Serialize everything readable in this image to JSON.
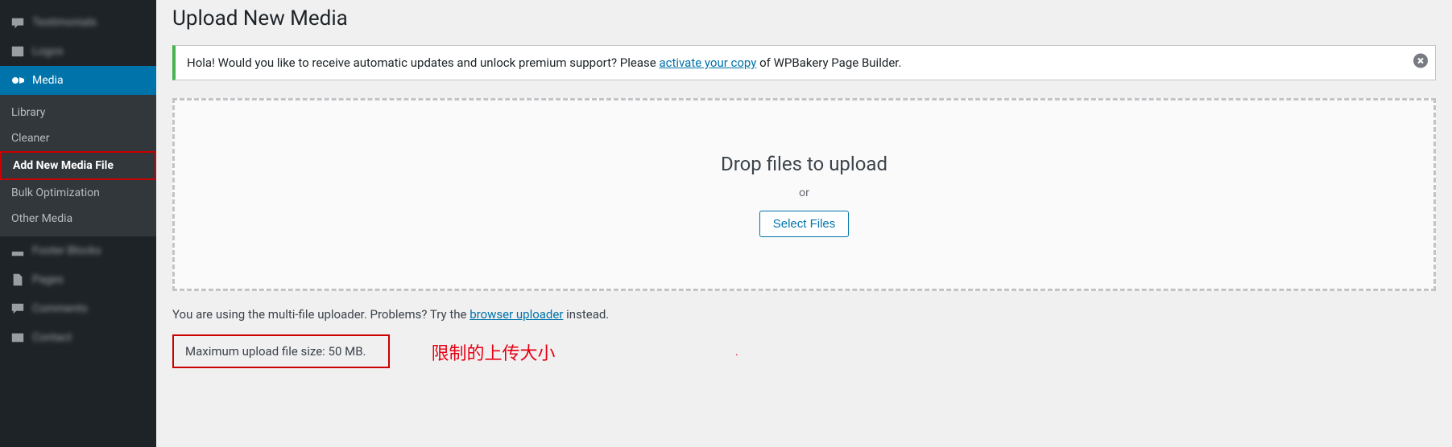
{
  "page_title": "Upload New Media",
  "sidebar": {
    "items": [
      {
        "label": "Testimonials"
      },
      {
        "label": "Logos"
      },
      {
        "label": "Media"
      },
      {
        "label": "Footer Blocks"
      },
      {
        "label": "Pages"
      },
      {
        "label": "Comments"
      },
      {
        "label": "Contact"
      }
    ],
    "media_submenu": {
      "items": [
        {
          "label": "Library"
        },
        {
          "label": "Cleaner"
        },
        {
          "label": "Add New Media File"
        },
        {
          "label": "Bulk Optimization"
        },
        {
          "label": "Other Media"
        }
      ]
    }
  },
  "notice": {
    "text_before": "Hola! Would you like to receive automatic updates and unlock premium support? Please ",
    "link_text": "activate your copy",
    "text_after": " of WPBakery Page Builder."
  },
  "dropzone": {
    "drop_text": "Drop files to upload",
    "or_text": "or",
    "button_label": "Select Files"
  },
  "help_text": {
    "before": "You are using the multi-file uploader. Problems? Try the ",
    "link": "browser uploader",
    "after": " instead."
  },
  "max_size_text": "Maximum upload file size: 50 MB.",
  "annotation_text": "限制的上传大小"
}
